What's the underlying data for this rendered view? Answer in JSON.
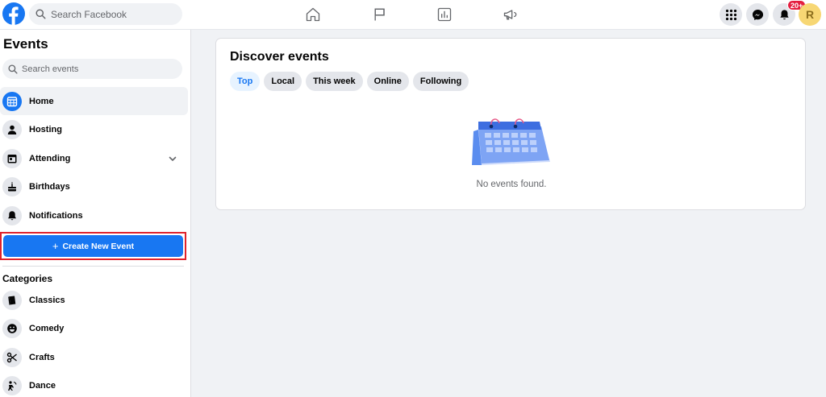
{
  "topbar": {
    "search_placeholder": "Search Facebook",
    "notifications_badge": "20+",
    "avatar_letter": "R"
  },
  "sidebar": {
    "title": "Events",
    "search_placeholder": "Search events",
    "items": [
      {
        "label": "Home",
        "icon": "calendar-grid-icon",
        "active": true
      },
      {
        "label": "Hosting",
        "icon": "person-icon"
      },
      {
        "label": "Attending",
        "icon": "calendar-icon",
        "has_chevron": true
      },
      {
        "label": "Birthdays",
        "icon": "cake-icon"
      },
      {
        "label": "Notifications",
        "icon": "bell-icon"
      }
    ],
    "create_button": {
      "plus": "+",
      "label": "Create New Event"
    },
    "categories_title": "Categories",
    "categories": [
      {
        "label": "Classics",
        "icon": "book-icon"
      },
      {
        "label": "Comedy",
        "icon": "laugh-face-icon"
      },
      {
        "label": "Crafts",
        "icon": "scissors-icon"
      },
      {
        "label": "Dance",
        "icon": "dance-icon"
      }
    ]
  },
  "main": {
    "title": "Discover events",
    "tabs": [
      {
        "label": "Top",
        "active": true
      },
      {
        "label": "Local"
      },
      {
        "label": "This week"
      },
      {
        "label": "Online"
      },
      {
        "label": "Following"
      }
    ],
    "empty_message": "No events found."
  },
  "colors": {
    "brand": "#1877f2",
    "highlight_border": "#e0222b",
    "badge": "#e41e3f",
    "avatar_bg": "#f7d774"
  }
}
